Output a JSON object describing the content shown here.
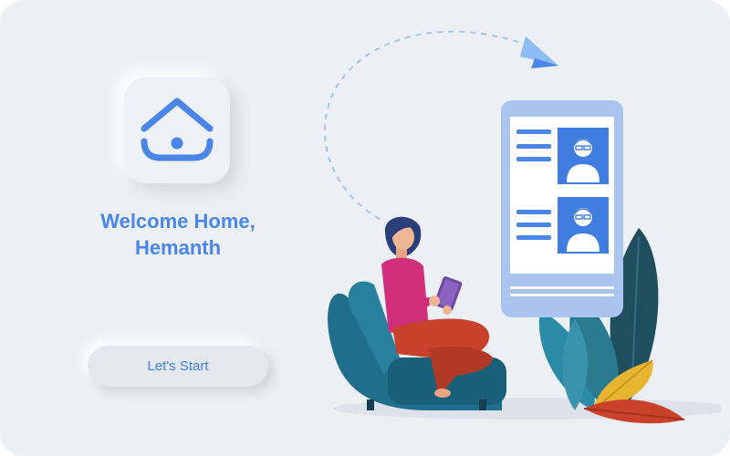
{
  "welcome": {
    "line1": "Welcome Home,",
    "line2": "Hemanth"
  },
  "start_button": {
    "label": "Let's Start"
  },
  "colors": {
    "accent": "#4a86e8",
    "background": "#eceff3",
    "chair": "#1f6e8c",
    "phone": "#a9c4ef"
  },
  "icons": {
    "logo": "home-icon",
    "paper_plane": "paper-plane-icon",
    "avatar": "user-avatar-icon"
  }
}
